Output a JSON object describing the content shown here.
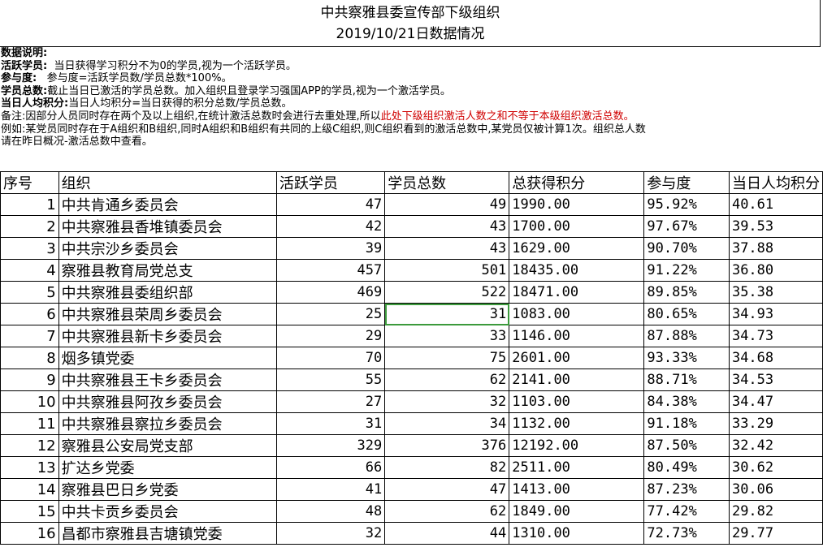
{
  "title": "中共察雅县委宣传部下级组织",
  "subtitle": "2019/10/21日数据情况",
  "notes": {
    "heading": "数据说明:",
    "active_label": "活跃学员:",
    "active_text": "当日获得学习积分不为0的学员,视为一个活跃学员。",
    "participation_label": "参与度:",
    "participation_text": "参与度=活跃学员数/学员总数*100%。",
    "total_label": "学员总数:",
    "total_text": "截止当日已激活的学员总数。加入组织且登录学习强国APP的学员,视为一个激活学员。",
    "avg_label": "当日人均积分:",
    "avg_text": "当日人均积分=当日获得的积分总数/学员总数。",
    "remark_text": "备注:因部分人员同时存在两个及以上组织,在统计激活总数时会进行去重处理,所以",
    "remark_red": "此处下级组织激活人数之和不等于本级组织激活总数。",
    "example_text": "例如:某党员同时存在于A组织和B组织,同时A组织和B组织有共同的上级C组织,则C组织看到的激活总数中,某党员仅被计算1次。组织总人数",
    "example_text2": "请在昨日概况-激活总数中查看。"
  },
  "table": {
    "headers": [
      "序号",
      "组织",
      "活跃学员",
      "学员总数",
      "总获得积分",
      "参与度",
      "当日人均积分"
    ],
    "rows": [
      [
        "1",
        "中共肯通乡委员会",
        "47",
        "49",
        "1990.00",
        "95.92%",
        "40.61"
      ],
      [
        "2",
        "中共察雅县香堆镇委员会",
        "42",
        "43",
        "1700.00",
        "97.67%",
        "39.53"
      ],
      [
        "3",
        "中共宗沙乡委员会",
        "39",
        "43",
        "1629.00",
        "90.70%",
        "37.88"
      ],
      [
        "4",
        "察雅县教育局党总支",
        "457",
        "501",
        "18435.00",
        "91.22%",
        "36.80"
      ],
      [
        "5",
        "中共察雅县委组织部",
        "469",
        "522",
        "18471.00",
        "89.85%",
        "35.38"
      ],
      [
        "6",
        "中共察雅县荣周乡委员会",
        "25",
        "31",
        "1083.00",
        "80.65%",
        "34.93"
      ],
      [
        "7",
        "中共察雅县新卡乡委员会",
        "29",
        "33",
        "1146.00",
        "87.88%",
        "34.73"
      ],
      [
        "8",
        "烟多镇党委",
        "70",
        "75",
        "2601.00",
        "93.33%",
        "34.68"
      ],
      [
        "9",
        "中共察雅县王卡乡委员会",
        "55",
        "62",
        "2141.00",
        "88.71%",
        "34.53"
      ],
      [
        "10",
        "中共察雅县阿孜乡委员会",
        "27",
        "32",
        "1103.00",
        "84.38%",
        "34.47"
      ],
      [
        "11",
        "中共察雅县察拉乡委员会",
        "31",
        "34",
        "1132.00",
        "91.18%",
        "33.29"
      ],
      [
        "12",
        "察雅县公安局党支部",
        "329",
        "376",
        "12192.00",
        "87.50%",
        "32.42"
      ],
      [
        "13",
        "扩达乡党委",
        "66",
        "82",
        "2511.00",
        "80.49%",
        "30.62"
      ],
      [
        "14",
        "察雅县巴日乡党委",
        "41",
        "47",
        "1413.00",
        "87.23%",
        "30.06"
      ],
      [
        "15",
        "中共卡贡乡委员会",
        "48",
        "62",
        "1849.00",
        "77.42%",
        "29.82"
      ],
      [
        "16",
        "昌都市察雅县吉塘镇党委",
        "32",
        "44",
        "1310.00",
        "72.73%",
        "29.77"
      ]
    ]
  }
}
